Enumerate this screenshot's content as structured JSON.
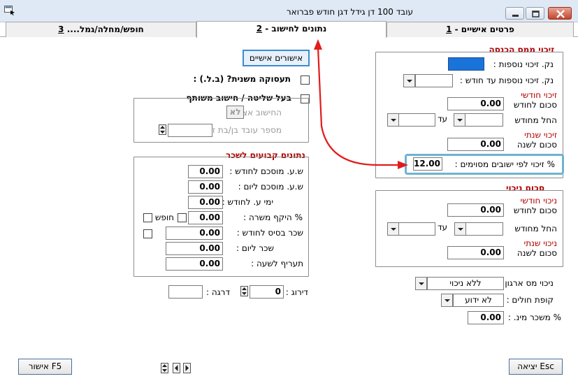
{
  "window": {
    "title": "עובד 100 דן גידל דגן   חודש פברואר"
  },
  "tabs": [
    {
      "number": "1",
      "label": "פרטים אישיים - ",
      "active": false
    },
    {
      "number": "2",
      "label": "נתונים לחישוב - ",
      "active": true
    },
    {
      "number": "3",
      "label": "חופש/מחלה/גמל.... ",
      "active": false
    }
  ],
  "personal_approvals_button": "אישורים אישיים",
  "secondary_occupation": {
    "label": "תעסוקה משנית? (ב.ל.) :",
    "checked": false
  },
  "controlling_owner": {
    "label": "בעל שליטה / חישוב משותף",
    "checked": false,
    "calc_at_label": "החישוב אצלי :",
    "calc_at_value": "לא",
    "spouse_employee_label": "מספר עובד בן/בת זוג :",
    "spouse_employee_value": ""
  },
  "credit_points": {
    "title": "זיכוי ממס הכנסה",
    "extra_points_label": "נק. זיכוי נוספות :",
    "extra_points_value": "",
    "extra_until_label": "נק. זיכוי נוספות עד חודש :",
    "extra_until_value": "",
    "monthly_heading": "זיכוי חודשי",
    "monthly_amount_label": "סכום לחודש",
    "monthly_amount_value": "0.00",
    "from_month_label": "החל מחודש",
    "until_label": "עד",
    "from_month_value": "",
    "until_value": "",
    "annual_heading": "זיכוי שנתי",
    "annual_amount_label": "סכום לשנה",
    "annual_amount_value": "0.00",
    "settlement_label": "% זיכוי לפי ישובים מסוימים :",
    "settlement_value": "12.00"
  },
  "deductions": {
    "title": "סכום ניכוי",
    "monthly_heading": "ניכוי חודשי",
    "monthly_amount_label": "סכום לחודש",
    "monthly_amount_value": "0.00",
    "from_month_label": "החל מחודש",
    "until_label": "עד",
    "from_month_value": "",
    "until_value": "",
    "annual_heading": "ניכוי שנתי",
    "annual_amount_label": "סכום לשנה",
    "annual_amount_value": "0.00"
  },
  "org_tax_deduction": {
    "label": "ניכוי מס ארגון :",
    "value": "ללא ניכוי"
  },
  "health_fund": {
    "label": "קופת חולים :",
    "value": "לא ידוע"
  },
  "min_salary_pct": {
    "label": "% משכר מינ. :",
    "value": "0.00"
  },
  "salary_fixed": {
    "title": "נתונים קבועים לשכר",
    "rows": [
      {
        "label": "ש.ע. מוסכם לחודש :",
        "value": "0.00"
      },
      {
        "label": "ש.ע. מוסכם ליום :",
        "value": "0.00"
      },
      {
        "label": "ימי ע. לחודש :",
        "value": "0.00"
      },
      {
        "label": "% היקף משרה :",
        "value": "0.00"
      },
      {
        "label": "שכר בסיס לחודש :",
        "value": "0.00"
      },
      {
        "label": "שכר ליום :",
        "value": "0.00"
      },
      {
        "label": "תעריף לשעה :",
        "value": "0.00"
      }
    ],
    "vacation_label": "חופש"
  },
  "grading": {
    "label": "דירוג :",
    "value": "0"
  },
  "grade": {
    "label": "דרגה :",
    "value": ""
  },
  "footer": {
    "ok_button": "אישור F5",
    "exit_button": "יציאה Esc"
  }
}
